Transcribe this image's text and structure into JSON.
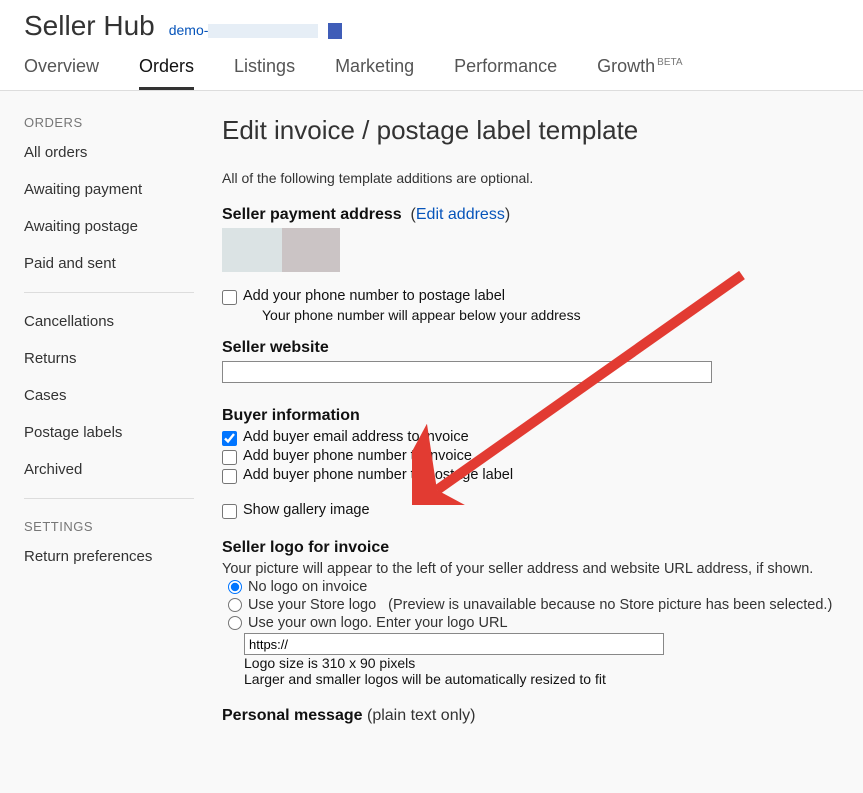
{
  "header": {
    "title": "Seller Hub",
    "account_prefix": "demo-"
  },
  "nav": {
    "tabs": [
      "Overview",
      "Orders",
      "Listings",
      "Marketing",
      "Performance",
      "Growth"
    ],
    "beta_suffix": "BETA",
    "active_index": 1
  },
  "sidebar": {
    "heading_orders": "ORDERS",
    "orders_items": [
      "All orders",
      "Awaiting payment",
      "Awaiting postage",
      "Paid and sent"
    ],
    "manage_items": [
      "Cancellations",
      "Returns",
      "Cases",
      "Postage labels",
      "Archived"
    ],
    "heading_settings": "SETTINGS",
    "settings_items": [
      "Return preferences"
    ]
  },
  "main": {
    "page_title": "Edit invoice / postage label template",
    "intro": "All of the following template additions are optional.",
    "seller_payment_heading": "Seller payment address",
    "edit_address_link": "Edit address",
    "phone_checkbox_label": "Add your phone number to postage label",
    "phone_sub_note": "Your phone number will appear below your address",
    "seller_website_heading": "Seller website",
    "seller_website_value": "",
    "buyer_info_heading": "Buyer information",
    "buyer_checks": [
      {
        "label": "Add buyer email address to invoice",
        "checked": true
      },
      {
        "label": "Add buyer phone number to invoice",
        "checked": false
      },
      {
        "label": "Add buyer phone number to postage label",
        "checked": false
      }
    ],
    "gallery_label": "Show gallery image",
    "logo_heading": "Seller logo for invoice",
    "logo_help": "Your picture will appear to the left of your seller address and website URL address, if shown.",
    "logo_options": {
      "none": "No logo on invoice",
      "store": "Use your Store logo",
      "store_note": "(Preview is unavailable because no Store picture has been selected.)",
      "own": "Use your own logo. Enter your logo URL"
    },
    "logo_url_value": "https://",
    "logo_size_note1": "Logo size is 310 x 90 pixels",
    "logo_size_note2": "Larger and smaller logos will be automatically resized to fit",
    "personal_msg_heading": "Personal message",
    "personal_msg_suffix": "(plain text only)"
  }
}
